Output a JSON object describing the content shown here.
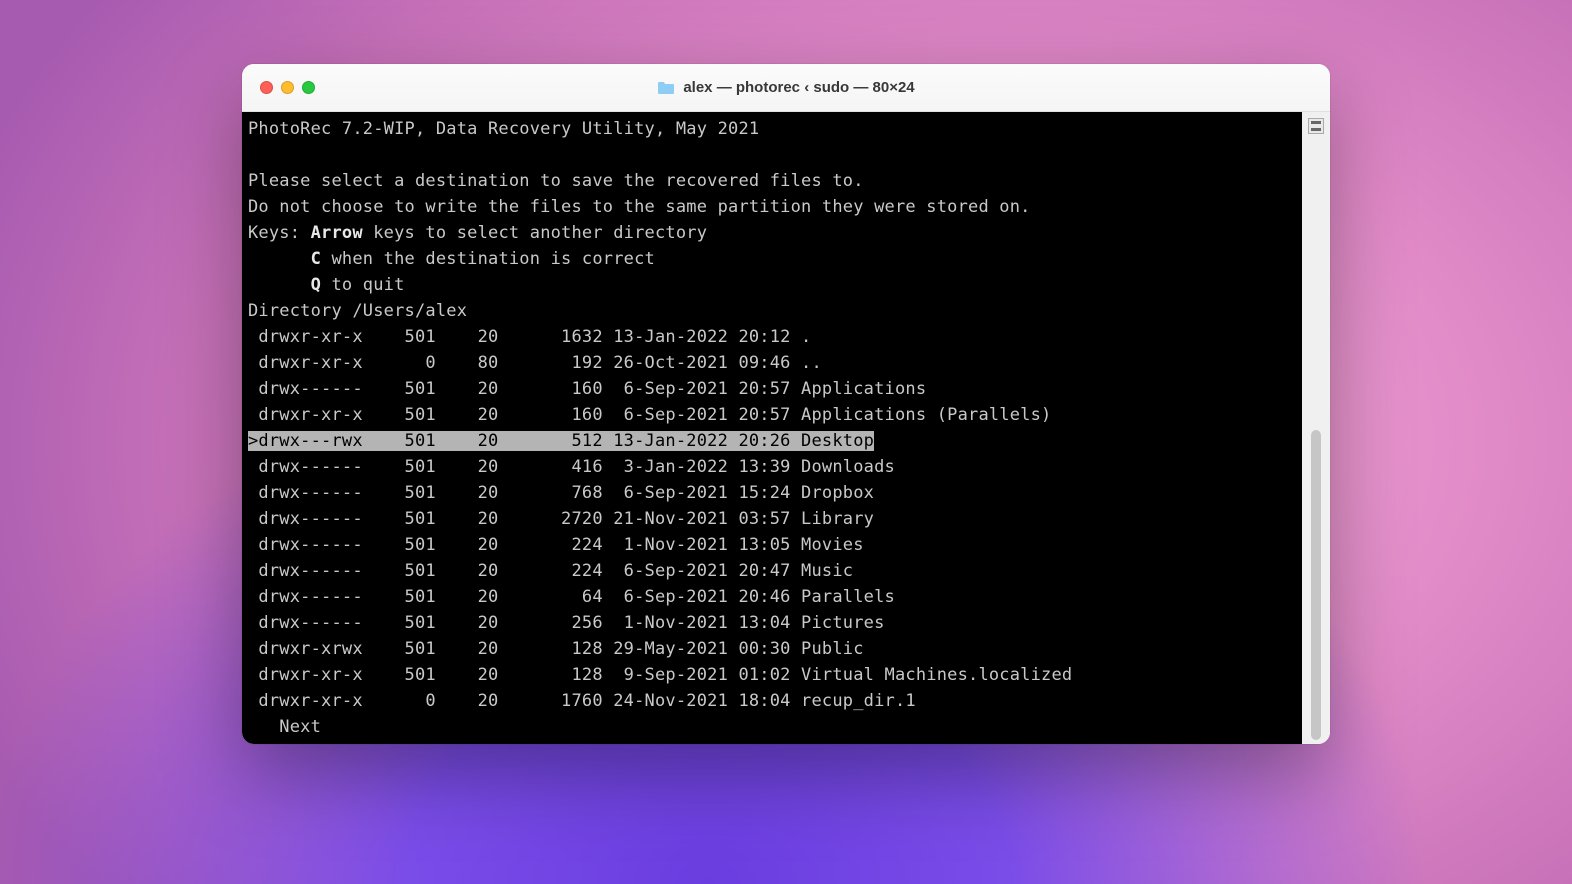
{
  "window": {
    "title": "alex — photorec ‹ sudo — 80×24"
  },
  "header_line": "PhotoRec 7.2-WIP, Data Recovery Utility, May 2021",
  "instructions": {
    "line1": "Please select a destination to save the recovered files to.",
    "line2": "Do not choose to write the files to the same partition they were stored on.",
    "keys_prefix": "Keys: ",
    "arrow_bold": "Arrow",
    "arrow_rest": " keys to select another directory",
    "c_bold": "C",
    "c_rest": " when the destination is correct",
    "q_bold": "Q",
    "q_rest": " to quit"
  },
  "directory_label": "Directory /Users/alex",
  "rows": [
    {
      "perm": "drwxr-xr-x",
      "uid": "501",
      "gid": " 20",
      "size": "1632",
      "date": "13-Jan-2022 20:12",
      "name": ".",
      "selected": false
    },
    {
      "perm": "drwxr-xr-x",
      "uid": "  0",
      "gid": " 80",
      "size": " 192",
      "date": "26-Oct-2021 09:46",
      "name": "..",
      "selected": false
    },
    {
      "perm": "drwx------",
      "uid": "501",
      "gid": " 20",
      "size": " 160",
      "date": " 6-Sep-2021 20:57",
      "name": "Applications",
      "selected": false
    },
    {
      "perm": "drwxr-xr-x",
      "uid": "501",
      "gid": " 20",
      "size": " 160",
      "date": " 6-Sep-2021 20:57",
      "name": "Applications (Parallels)",
      "selected": false
    },
    {
      "perm": "drwx---rwx",
      "uid": "501",
      "gid": " 20",
      "size": " 512",
      "date": "13-Jan-2022 20:26",
      "name": "Desktop",
      "selected": true
    },
    {
      "perm": "drwx------",
      "uid": "501",
      "gid": " 20",
      "size": " 416",
      "date": " 3-Jan-2022 13:39",
      "name": "Downloads",
      "selected": false
    },
    {
      "perm": "drwx------",
      "uid": "501",
      "gid": " 20",
      "size": " 768",
      "date": " 6-Sep-2021 15:24",
      "name": "Dropbox",
      "selected": false
    },
    {
      "perm": "drwx------",
      "uid": "501",
      "gid": " 20",
      "size": "2720",
      "date": "21-Nov-2021 03:57",
      "name": "Library",
      "selected": false
    },
    {
      "perm": "drwx------",
      "uid": "501",
      "gid": " 20",
      "size": " 224",
      "date": " 1-Nov-2021 13:05",
      "name": "Movies",
      "selected": false
    },
    {
      "perm": "drwx------",
      "uid": "501",
      "gid": " 20",
      "size": " 224",
      "date": " 6-Sep-2021 20:47",
      "name": "Music",
      "selected": false
    },
    {
      "perm": "drwx------",
      "uid": "501",
      "gid": " 20",
      "size": "  64",
      "date": " 6-Sep-2021 20:46",
      "name": "Parallels",
      "selected": false
    },
    {
      "perm": "drwx------",
      "uid": "501",
      "gid": " 20",
      "size": " 256",
      "date": " 1-Nov-2021 13:04",
      "name": "Pictures",
      "selected": false
    },
    {
      "perm": "drwxr-xrwx",
      "uid": "501",
      "gid": " 20",
      "size": " 128",
      "date": "29-May-2021 00:30",
      "name": "Public",
      "selected": false
    },
    {
      "perm": "drwxr-xr-x",
      "uid": "501",
      "gid": " 20",
      "size": " 128",
      "date": " 9-Sep-2021 01:02",
      "name": "Virtual Machines.localized",
      "selected": false
    },
    {
      "perm": "drwxr-xr-x",
      "uid": "  0",
      "gid": " 20",
      "size": "1760",
      "date": "24-Nov-2021 18:04",
      "name": "recup_dir.1",
      "selected": false
    }
  ],
  "footer": "   Next"
}
